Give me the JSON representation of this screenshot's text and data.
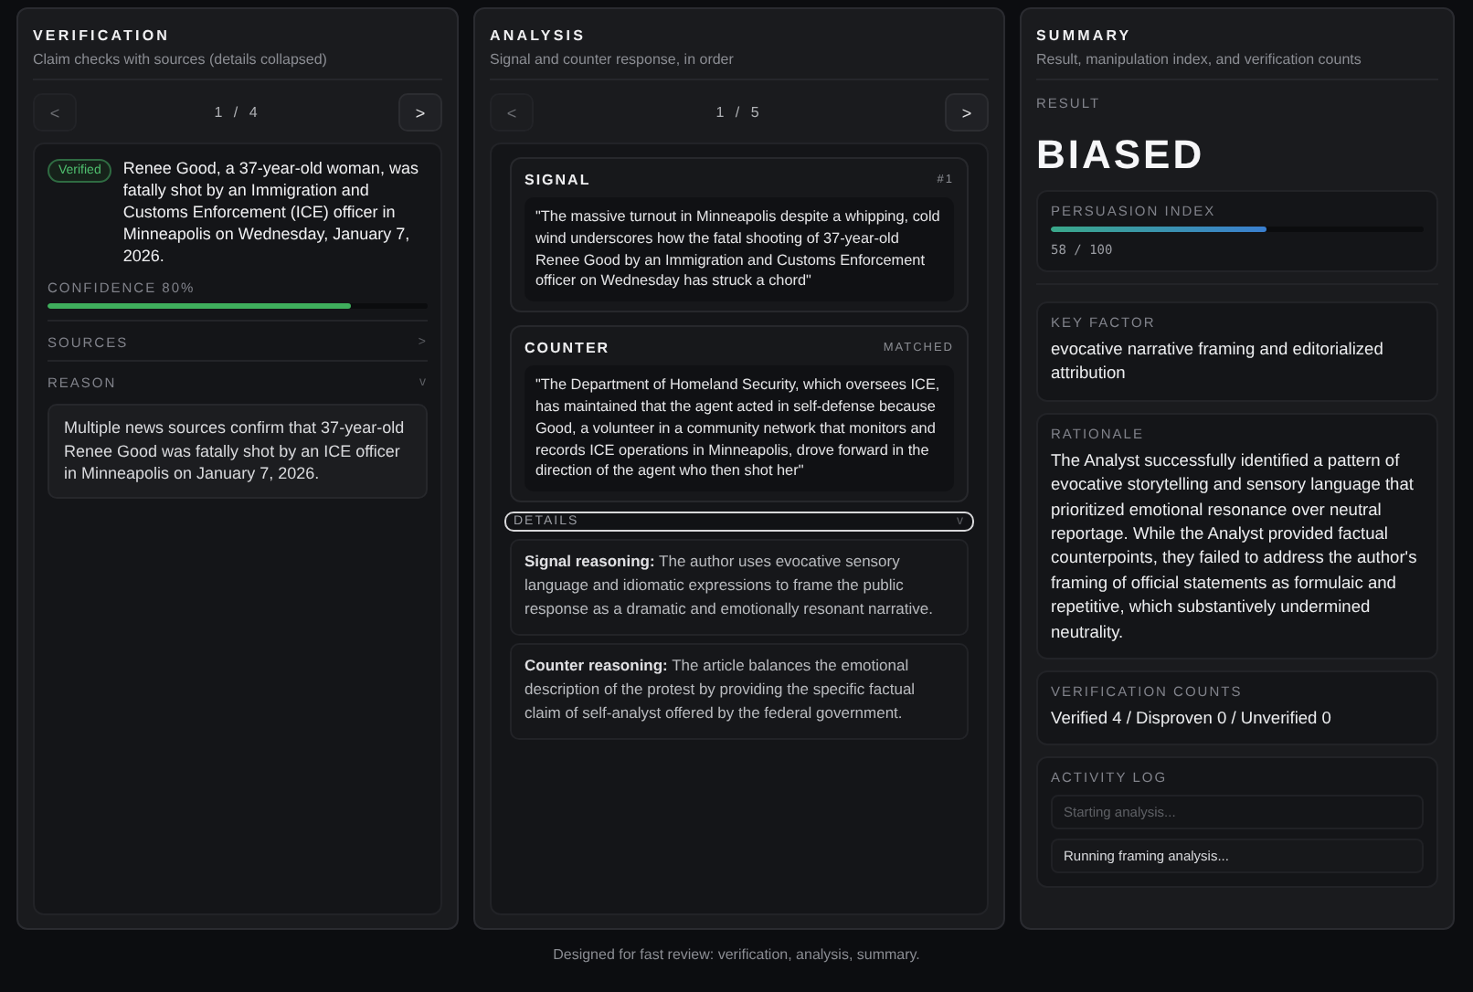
{
  "verification": {
    "title": "VERIFICATION",
    "subtitle": "Claim checks with sources (details collapsed)",
    "pager": {
      "prev": {
        "label": "<",
        "disabled": true
      },
      "position": "1 / 4",
      "next": {
        "label": ">",
        "disabled": false
      }
    },
    "claim": {
      "status": "Verified",
      "text": "Renee Good, a 37-year-old woman, was fatally shot by an Immigration and Customs Enforcement (ICE) officer in Minneapolis on Wednesday, January 7, 2026.",
      "confidence": "CONFIDENCE 80%",
      "level": 0.8,
      "sections": [
        {
          "label": "SOURCES",
          "chevron": ">"
        },
        {
          "label": "REASON",
          "chevron": "v",
          "body": "Multiple news sources confirm that 37-year-old Renee Good was fatally shot by an ICE officer in Minneapolis on January 7, 2026."
        }
      ]
    }
  },
  "analysis": {
    "title": "ANALYSIS",
    "subtitle": "Signal and counter response, in order",
    "pager": {
      "prev": {
        "label": "<",
        "disabled": true
      },
      "position": "1 / 5",
      "next": {
        "label": ">",
        "disabled": false
      }
    },
    "cards": [
      {
        "label": "SIGNAL",
        "badge": "#1",
        "quote": "\"The massive turnout in Minneapolis despite a whipping, cold wind underscores how the fatal shooting of 37-year-old Renee Good by an Immigration and Customs Enforcement officer on Wednesday has struck a chord\""
      },
      {
        "label": "COUNTER",
        "badge": "MATCHED",
        "quote": "\"The Department of Homeland Security, which oversees ICE, has maintained that the agent acted in self-defense because Good, a volunteer in a community network that monitors and records ICE operations in Minneapolis, drove forward in the direction of the agent who then shot her\""
      }
    ],
    "details": {
      "label": "DETAILS",
      "chevron": "v",
      "items": [
        "**Signal reasoning:** The author uses evocative sensory language and idiomatic expressions to frame the public response as a dramatic and emotionally resonant narrative.",
        "**Counter reasoning:** The article balances the emotional description of the protest by providing the specific factual claim of self-analyst offered by the federal government."
      ]
    }
  },
  "summary": {
    "title": "SUMMARY",
    "subtitle": "Result, manipulation index, and verification counts",
    "result_label": "RESULT",
    "result": "BIASED",
    "persuasion": {
      "label": "PERSUASION INDEX",
      "level": 0.58,
      "reading": "58 / 100"
    },
    "key_factor": {
      "label": "KEY FACTOR",
      "text": "evocative narrative framing and editorialized attribution"
    },
    "rationale": {
      "label": "RATIONALE",
      "text": "The Analyst successfully identified a pattern of evocative storytelling and sensory language that prioritized emotional resonance over neutral reportage. While the Analyst provided factual counterpoints, they failed to address the author's framing of official statements as formulaic and repetitive, which substantively undermined neutrality."
    },
    "counts": {
      "label": "VERIFICATION COUNTS",
      "text": "Verified 4 / Disproven 0 / Unverified 0"
    },
    "activity_log": {
      "label": "ACTIVITY LOG",
      "entries": [
        {
          "text": "Starting analysis...",
          "latest": false
        },
        {
          "text": "Running framing analysis...",
          "latest": true
        }
      ]
    }
  },
  "footer": "Designed for fast review: verification, analysis, summary."
}
